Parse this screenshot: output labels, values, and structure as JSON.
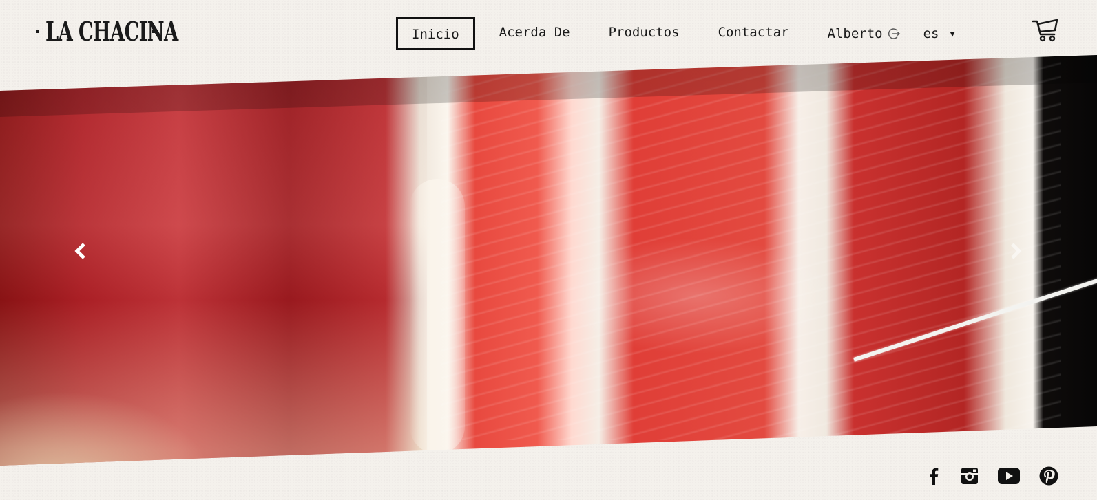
{
  "brand": {
    "name": "LA CHACINA"
  },
  "nav": {
    "items": [
      {
        "label": "Inicio",
        "active": true
      },
      {
        "label": "Acerda De",
        "active": false
      },
      {
        "label": "Productos",
        "active": false
      },
      {
        "label": "Contactar",
        "active": false
      }
    ],
    "user": {
      "label": "Alberto",
      "icon": "logout-icon"
    },
    "language": {
      "selected": "es",
      "icon": "caret-down-icon"
    },
    "cart_icon": "cart-icon"
  },
  "slider": {
    "image": "jamon-iberico-slice",
    "prev_icon": "chevron-left-icon",
    "next_icon": "chevron-right-icon"
  },
  "social": {
    "icons": [
      "facebook-icon",
      "instagram-icon",
      "youtube-icon",
      "pinterest-icon"
    ]
  },
  "colors": {
    "text": "#1a1a1a",
    "background": "#f4f1ec",
    "active_border": "#111111"
  }
}
